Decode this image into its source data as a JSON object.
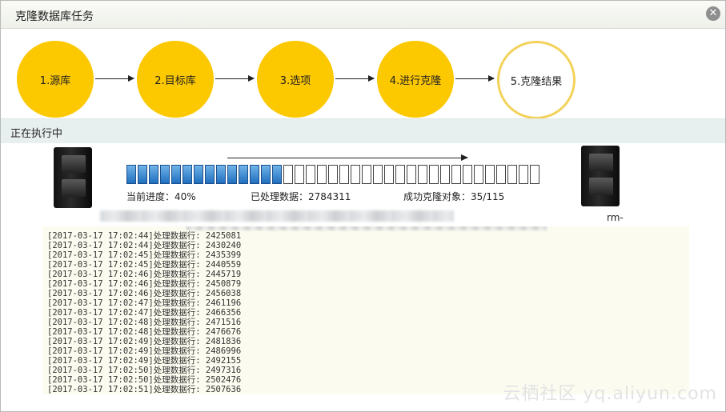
{
  "dialog": {
    "title": "克隆数据库任务",
    "close_glyph": "✕"
  },
  "steps": [
    {
      "label": "1.源库",
      "state": "done"
    },
    {
      "label": "2.目标库",
      "state": "done"
    },
    {
      "label": "3.选项",
      "state": "done"
    },
    {
      "label": "4.进行克隆",
      "state": "done"
    },
    {
      "label": "5.克隆结果",
      "state": "current"
    }
  ],
  "status": {
    "label": "正在执行中"
  },
  "progress": {
    "percent": 40,
    "total_cells": 37,
    "filled_cells": 14,
    "current_label": "当前进度：40%",
    "processed_label": "已处理数据：2784311",
    "objects_label": "成功克隆对象：35/115"
  },
  "target": {
    "label": "rm-"
  },
  "log": {
    "lines": [
      "[2017-03-17 17:02:44]处理数据行: 2425081",
      "[2017-03-17 17:02:44]处理数据行: 2430240",
      "[2017-03-17 17:02:45]处理数据行: 2435399",
      "[2017-03-17 17:02:45]处理数据行: 2440559",
      "[2017-03-17 17:02:46]处理数据行: 2445719",
      "[2017-03-17 17:02:46]处理数据行: 2450879",
      "[2017-03-17 17:02:46]处理数据行: 2456038",
      "[2017-03-17 17:02:47]处理数据行: 2461196",
      "[2017-03-17 17:02:47]处理数据行: 2466356",
      "[2017-03-17 17:02:48]处理数据行: 2471516",
      "[2017-03-17 17:02:48]处理数据行: 2476676",
      "[2017-03-17 17:02:49]处理数据行: 2481836",
      "[2017-03-17 17:02:49]处理数据行: 2486996",
      "[2017-03-17 17:02:49]处理数据行: 2492155",
      "[2017-03-17 17:02:50]处理数据行: 2497316",
      "[2017-03-17 17:02:50]处理数据行: 2502476",
      "[2017-03-17 17:02:51]处理数据行: 2507636"
    ]
  },
  "watermark": "云栖社区 yq.aliyun.com",
  "colors": {
    "step_done": "#fcc800",
    "progress_fill": "#1f6fc0",
    "section_bg": "#e8f0ef",
    "log_bg": "#fbfbef"
  }
}
